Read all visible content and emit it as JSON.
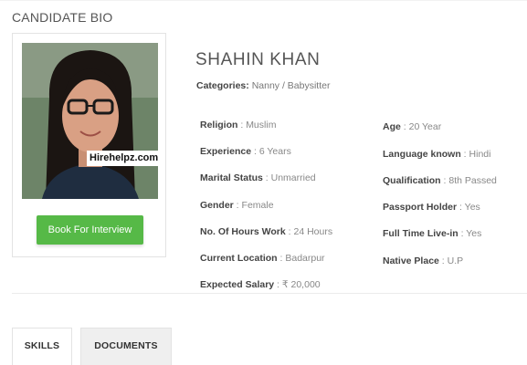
{
  "section": {
    "title": "CANDIDATE BIO"
  },
  "candidate": {
    "name": "SHAHIN KHAN",
    "categories_label": "Categories:",
    "categories_value": "Nanny / Babysitter",
    "watermark": "Hirehelpz.com",
    "book_button": "Book For Interview"
  },
  "details_left": [
    {
      "label": "Religion",
      "value": "Muslim"
    },
    {
      "label": "Experience",
      "value": "6 Years"
    },
    {
      "label": "Marital Status",
      "value": "Unmarried"
    },
    {
      "label": "Gender",
      "value": "Female"
    },
    {
      "label": "No. Of Hours Work",
      "value": "24 Hours"
    },
    {
      "label": "Current Location",
      "value": "Badarpur"
    },
    {
      "label": "Expected Salary",
      "value": "₹ 20,000"
    }
  ],
  "details_right": [
    {
      "label": "Age",
      "value": "20 Year"
    },
    {
      "label": "Language known",
      "value": "Hindi"
    },
    {
      "label": "Qualification",
      "value": "8th Passed"
    },
    {
      "label": "Passport Holder",
      "value": "Yes"
    },
    {
      "label": "Full Time Live-in",
      "value": "Yes"
    },
    {
      "label": "Native Place",
      "value": "U.P"
    }
  ],
  "separator": " : ",
  "tabs": [
    {
      "label": "SKILLS"
    },
    {
      "label": "DOCUMENTS"
    }
  ],
  "colors": {
    "button_bg": "#56b947",
    "label": "#444444",
    "value": "#888888"
  }
}
